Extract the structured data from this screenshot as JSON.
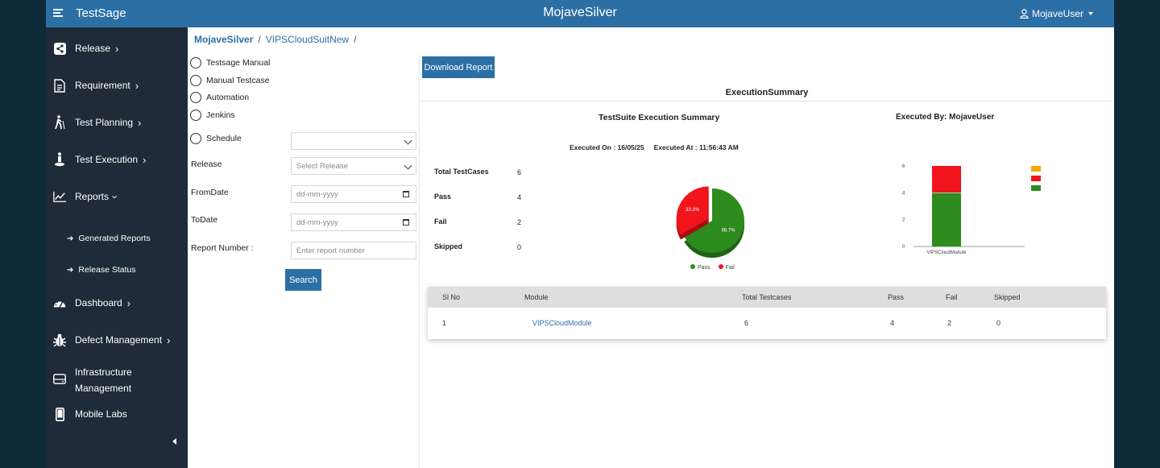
{
  "topbar": {
    "brand": "TestSage",
    "title": "MojaveSilver",
    "user": "MojaveUser"
  },
  "sidebar": {
    "items": [
      {
        "label": "Release",
        "icon": "share-icon"
      },
      {
        "label": "Requirement",
        "icon": "document-icon"
      },
      {
        "label": "Test Planning",
        "icon": "walking-person-icon"
      },
      {
        "label": "Test Execution",
        "icon": "person-stand-icon"
      },
      {
        "label": "Reports",
        "icon": "line-chart-icon"
      },
      {
        "label": "Dashboard",
        "icon": "gauge-icon"
      },
      {
        "label": "Defect Management",
        "icon": "bug-icon"
      },
      {
        "label": "Infrastructure",
        "label2": "Management",
        "icon": "server-icon"
      },
      {
        "label": "Mobile Labs",
        "icon": "mobile-icon"
      }
    ],
    "subitems": [
      "Generated Reports",
      "Release Status"
    ]
  },
  "breadcrumb": {
    "project": "MojaveSilver",
    "suite": "VIPSCloudSuitNew"
  },
  "filters": {
    "radios": [
      "Testsage Manual",
      "Manual Testcase",
      "Automation",
      "Jenkins",
      "Schedule"
    ],
    "release_label": "Release",
    "release_placeholder": "Select Release",
    "from_label": "FromDate",
    "to_label": "ToDate",
    "date_placeholder": "dd-mm-yyyy",
    "report_label": "Report Number :",
    "report_placeholder": "Enter report number",
    "search_label": "Search"
  },
  "report": {
    "download_label": "Download Report",
    "title": "ExecutionSummary",
    "suite_title": "TestSuite Execution Summary",
    "executed_by": "Executed By:  MojaveUser",
    "executed_on": "Executed On : 16/05/25",
    "executed_at": "Executed At : 11:56:43 AM",
    "stats": [
      {
        "label": "Total TestCases",
        "value": "6"
      },
      {
        "label": "Pass",
        "value": "4"
      },
      {
        "label": "Fail",
        "value": "2"
      },
      {
        "label": "Skipped",
        "value": "0"
      }
    ]
  },
  "chart_data": [
    {
      "type": "pie",
      "categories": [
        "Pass",
        "Fail"
      ],
      "values": [
        66.7,
        33.3
      ],
      "labels": [
        "66.7%",
        "33.3%"
      ],
      "colors": [
        "#2e8b1e",
        "#f2141c"
      ],
      "legend": "bottom"
    },
    {
      "type": "bar",
      "stacked": true,
      "categories": [
        "VIPSCloudModule"
      ],
      "series": [
        {
          "values": [
            4
          ],
          "color": "#2e8b1e"
        },
        {
          "values": [
            2
          ],
          "color": "#f2141c"
        },
        {
          "values": [
            0
          ],
          "color": "#f2a900"
        }
      ],
      "ylim": [
        0,
        6
      ],
      "yticks": [
        "0",
        "2",
        "4",
        "6"
      ],
      "legend": "top-right"
    }
  ],
  "table": {
    "headers": [
      "Sl No",
      "Module",
      "Total Testcases",
      "Pass",
      "Fail",
      "Skipped"
    ],
    "rows": [
      [
        "1",
        "VIPSCloudModule",
        "6",
        "4",
        "2",
        "0"
      ]
    ]
  }
}
